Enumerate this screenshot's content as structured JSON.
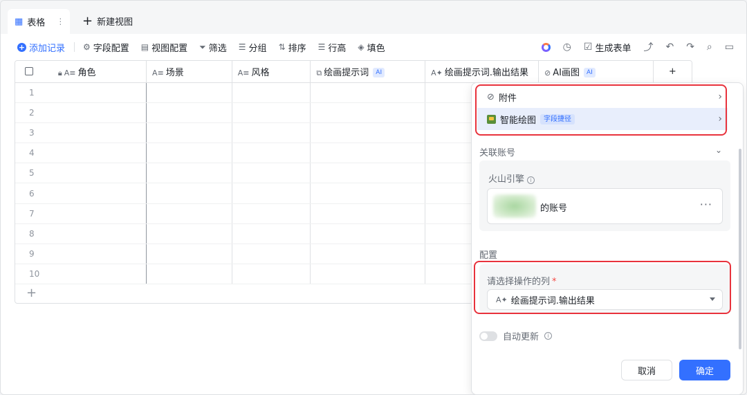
{
  "tabs": {
    "active_label": "表格",
    "new_view_label": "新建视图"
  },
  "toolbar": {
    "add_record": "添加记录",
    "field_config": "字段配置",
    "view_config": "视图配置",
    "filter": "筛选",
    "group": "分组",
    "sort": "排序",
    "row_height": "行高",
    "fill_color": "填色",
    "generate_form": "生成表单"
  },
  "columns": [
    {
      "label": "角色",
      "icon": "text-icon"
    },
    {
      "label": "场景",
      "icon": "text-icon"
    },
    {
      "label": "风格",
      "icon": "text-icon"
    },
    {
      "label": "绘画提示词",
      "icon": "ai-field-icon",
      "badge": "AI"
    },
    {
      "label": "绘画提示词.输出结果",
      "icon": "ai-text-icon"
    },
    {
      "label": "AI画图",
      "icon": "attachment-icon",
      "badge": "AI"
    }
  ],
  "rows": [
    "1",
    "2",
    "3",
    "4",
    "5",
    "6",
    "7",
    "8",
    "9",
    "10"
  ],
  "panel": {
    "dropdown": {
      "attachment": "附件",
      "smart_drawing": "智能绘图",
      "smart_drawing_tag": "字段捷径"
    },
    "account_section": "关联账号",
    "engine_label": "火山引擎",
    "account_name": "的账号",
    "config_section": "配置",
    "select_label": "请选择操作的列",
    "select_value": "绘画提示词.输出结果",
    "auto_update": "自动更新",
    "cancel": "取消",
    "confirm": "确定"
  },
  "colors": {
    "accent": "#3370ff",
    "highlight_box": "#e8323c"
  }
}
